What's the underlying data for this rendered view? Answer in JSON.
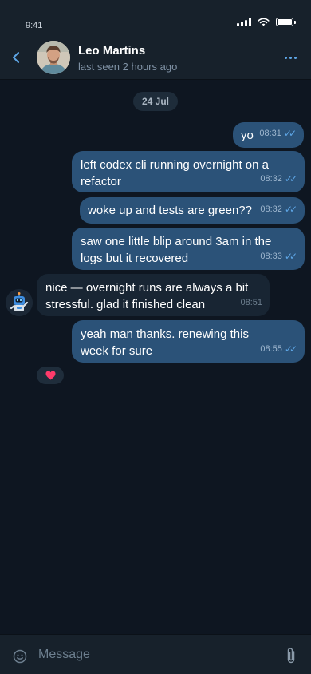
{
  "status_bar": {
    "time": "9:41"
  },
  "header": {
    "name": "Leo Martins",
    "status": "last seen 2 hours ago"
  },
  "date_separator": "24 Jul",
  "messages": [
    {
      "direction": "outgoing",
      "text": "yo",
      "time": "08:31",
      "read": true
    },
    {
      "direction": "outgoing",
      "text": "left codex cli running overnight on a refactor",
      "time": "08:32",
      "read": true
    },
    {
      "direction": "outgoing",
      "text": "woke up and tests are green??",
      "time": "08:32",
      "read": true
    },
    {
      "direction": "outgoing",
      "text": "saw one little blip around 3am in the logs but it recovered",
      "time": "08:33",
      "read": true
    },
    {
      "direction": "incoming",
      "text": "nice — overnight runs are always a bit stressful. glad it finished clean",
      "time": "08:51"
    },
    {
      "direction": "outgoing",
      "text": "yeah man thanks. renewing this week for sure",
      "time": "08:55",
      "read": true
    }
  ],
  "reaction": {
    "emoji": "heart"
  },
  "input": {
    "placeholder": "Message"
  },
  "colors": {
    "background": "#0e1621",
    "header": "#17212b",
    "outgoing_bubble": "#2b5278",
    "incoming_bubble": "#182533",
    "accent": "#5ea6e6",
    "reaction_heart": "#ff3b6b"
  },
  "icons": {
    "back": "chevron-left-icon",
    "more": "ellipsis-icon",
    "emoji": "smiley-icon",
    "attach": "paperclip-icon",
    "read_receipt": "double-check-icon"
  }
}
